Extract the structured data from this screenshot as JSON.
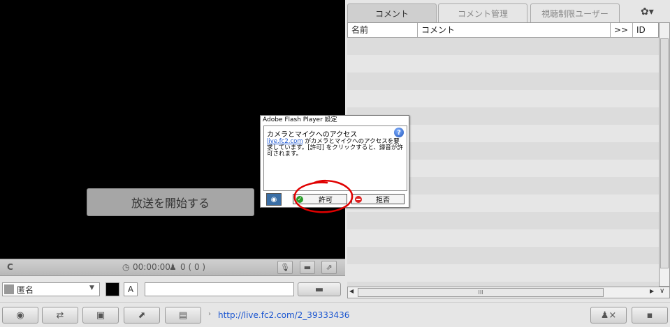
{
  "video": {
    "start_button": "放送を開始する"
  },
  "status_bar": {
    "refresh_icon": "C",
    "timer": "00:00:00",
    "viewers": "0 ( 0 )"
  },
  "input_row": {
    "name_value": "匿名",
    "font_label": "A",
    "comment_value": ""
  },
  "bottom_bar": {
    "url": "http://live.fc2.com/2_39333436"
  },
  "tabs": [
    {
      "label": "コメント"
    },
    {
      "label": "コメント管理"
    },
    {
      "label": "視聴制限ユーザー"
    }
  ],
  "table": {
    "headers": [
      "名前",
      "コメント",
      ">>",
      "ID"
    ]
  },
  "hscroll_label": "III",
  "flash_dialog": {
    "title": "Adobe Flash Player 設定",
    "heading": "カメラとマイクへのアクセス",
    "link": "live.fc2.com",
    "message": " がカメラとマイクへのアクセスを要求しています。[許可] をクリックすると、録音が許可されます。",
    "allow": "許可",
    "deny": "拒否"
  },
  "colors": {
    "annotation": "#e00000",
    "video_bg": "#000000",
    "link": "#1a55d0"
  }
}
